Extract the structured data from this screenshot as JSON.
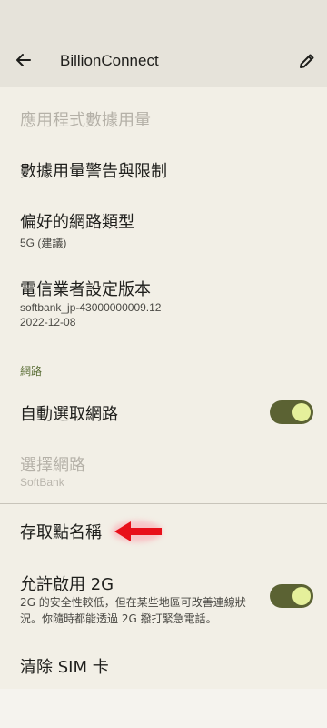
{
  "app_bar": {
    "title": "BillionConnect",
    "back_icon": "arrow-back-icon",
    "edit_icon": "pencil-icon"
  },
  "settings": {
    "app_data_usage": "應用程式數據用量",
    "data_warning_limit": "數據用量警告與限制",
    "preferred_network": {
      "title": "偏好的網路類型",
      "value": "5G (建議)"
    },
    "carrier_settings": {
      "title": "電信業者設定版本",
      "value_line1": "softbank_jp-43000000009.12",
      "value_line2": "2022-12-08"
    },
    "network_section_header": "網路",
    "auto_select_network": {
      "title": "自動選取網路",
      "enabled": true
    },
    "choose_network": {
      "title": "選擇網路",
      "value": "SoftBank"
    },
    "access_point_names": "存取點名稱",
    "allow_2g": {
      "title": "允許啟用 2G",
      "description": "2G 的安全性較低，但在某些地區可改善連線狀況。你隨時都能透過 2G 撥打緊急電話。",
      "enabled": true
    },
    "clear_sim": "清除 SIM 卡"
  },
  "colors": {
    "toggle_track": "#5b6233",
    "toggle_knob": "#e5f09b",
    "annotation_arrow": "#e8101a"
  }
}
